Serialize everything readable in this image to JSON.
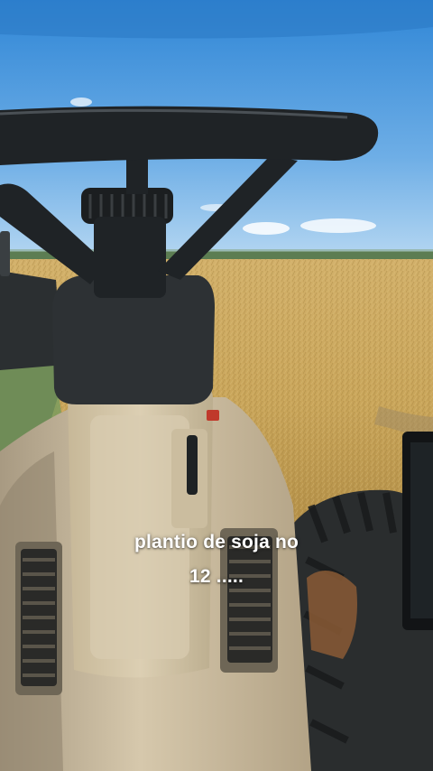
{
  "story": {
    "caption_line1": "plantio de soja no",
    "caption_line2": "12 ....."
  },
  "scene": {
    "subject": "tractor-cab-view-over-harvested-field",
    "colors": {
      "sky_top": "#2f86d6",
      "sky_bottom": "#9cc8ee",
      "field": "#c9a55a",
      "field_dark": "#a98a42",
      "dash": "#cfc1a5",
      "steering": "#1f2326",
      "tire": "#2a2d2e"
    }
  }
}
